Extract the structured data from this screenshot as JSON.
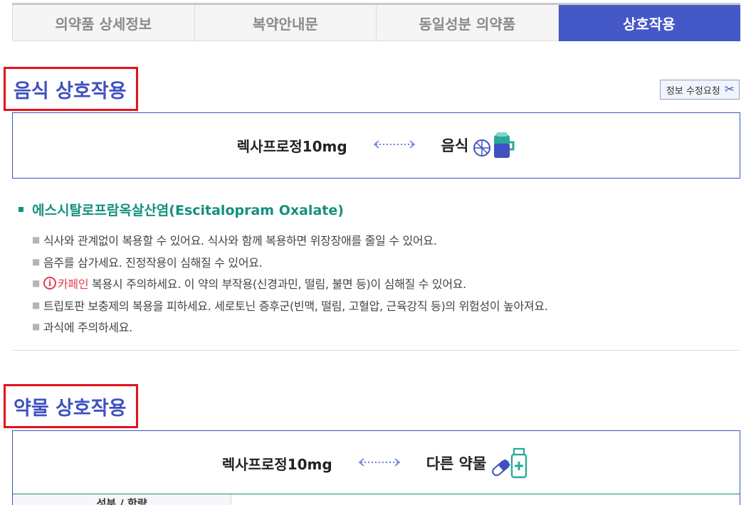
{
  "tabs": [
    {
      "label": "의약품 상세정보",
      "active": false
    },
    {
      "label": "복약안내문",
      "active": false
    },
    {
      "label": "동일성분 의약품",
      "active": false
    },
    {
      "label": "상호작용",
      "active": true
    }
  ],
  "food_section": {
    "title": "음식 상호작용",
    "edit_button": "정보 수정요청",
    "drug_name": "렉사프로정10mg",
    "target": "음식",
    "ingredient": "에스시탈로프람옥살산염(Escitalopram Oxalate)",
    "notes": [
      "식사와 관계없이 복용할 수 있어요. 식사와 함께 복용하면 위장장애를 줄일 수 있어요.",
      "음주를 삼가세요. 진정작용이 심해질 수 있어요.",
      "트립토판 보충제의 복용을 피하세요. 세로토닌 증후군(빈맥, 떨림, 고혈압, 근육강직 등)의 위험성이 높아져요.",
      "과식에 주의하세요."
    ],
    "caffeine_note": {
      "highlight": "카페인",
      "rest": " 복용시 주의하세요. 이 약의 부작용(신경과민, 떨림, 불면 등)이 심해질 수 있어요."
    }
  },
  "drug_section": {
    "title": "약물 상호작용",
    "drug_name": "렉사프로정10mg",
    "target": "다른 약물",
    "table_header": "성분 / 함량"
  },
  "colors": {
    "accent": "#3f51c0",
    "active_tab": "#4458c8",
    "ingredient": "#14907e",
    "highlight_box": "#e3121c",
    "caffeine": "#e03c4e"
  }
}
